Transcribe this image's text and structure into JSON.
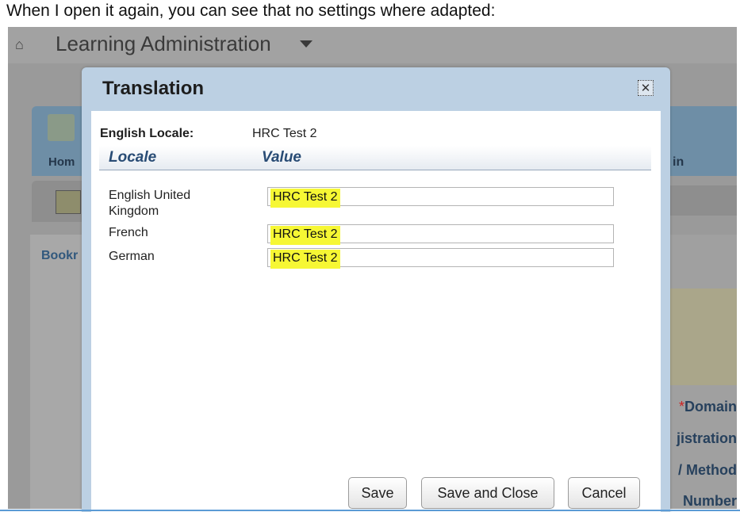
{
  "caption": "When I open it again, you can see that no settings where adapted:",
  "app": {
    "title": "Learning Administration",
    "home_icon": "home-icon",
    "background": {
      "home_label": "Hom",
      "right_label": "in",
      "bookmarks_label": "Bookr",
      "fields": [
        {
          "required": "*",
          "label": "Domain"
        },
        {
          "required": "",
          "label": "jistration"
        },
        {
          "required": "",
          "label": "/ Method"
        },
        {
          "required": "",
          "label": "Number"
        }
      ]
    }
  },
  "dialog": {
    "title": "Translation",
    "close_icon": "close-icon",
    "english_locale_label": "English Locale:",
    "english_locale_value": "HRC Test 2",
    "columns": {
      "locale": "Locale",
      "value": "Value"
    },
    "rows": [
      {
        "locale": "English United Kingdom",
        "value": "HRC Test 2"
      },
      {
        "locale": "French",
        "value": "HRC Test 2"
      },
      {
        "locale": "German",
        "value": "HRC Test 2"
      }
    ],
    "buttons": {
      "save": "Save",
      "save_close": "Save and Close",
      "cancel": "Cancel"
    },
    "highlight_color": "#f6f734"
  }
}
